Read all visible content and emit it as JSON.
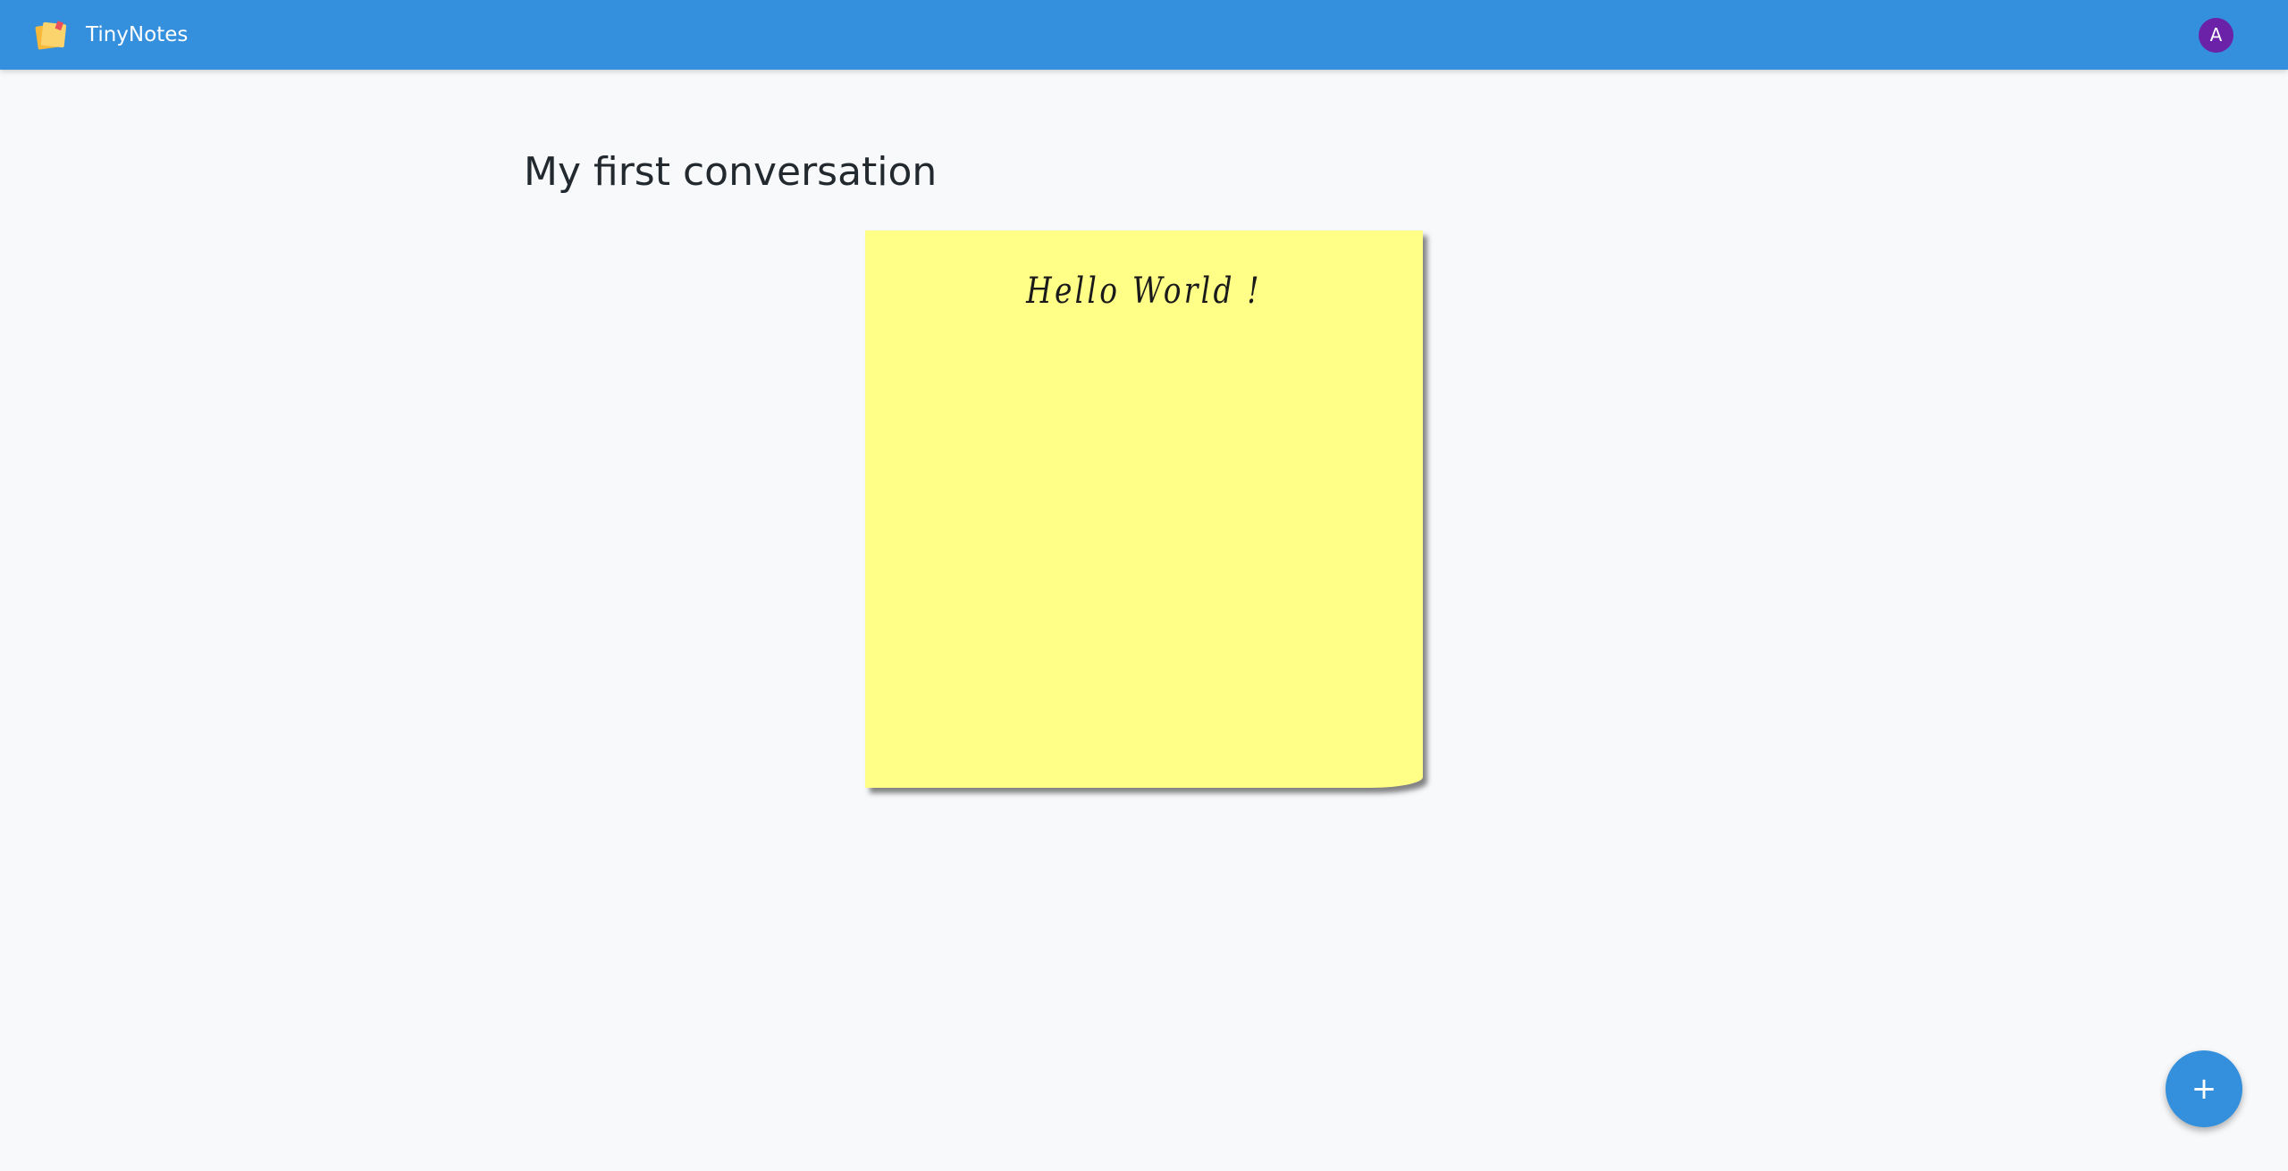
{
  "app": {
    "title": "TinyNotes",
    "logo_icon": "sticky-notes-icon",
    "accent_color": "#3490dc"
  },
  "user": {
    "avatar_initial": "A",
    "avatar_color": "#6b21a8"
  },
  "main": {
    "title": "My first conversation",
    "note": {
      "text": "Hello World !",
      "color": "#ffff88"
    }
  },
  "fab": {
    "label": "+",
    "icon": "plus-icon"
  }
}
